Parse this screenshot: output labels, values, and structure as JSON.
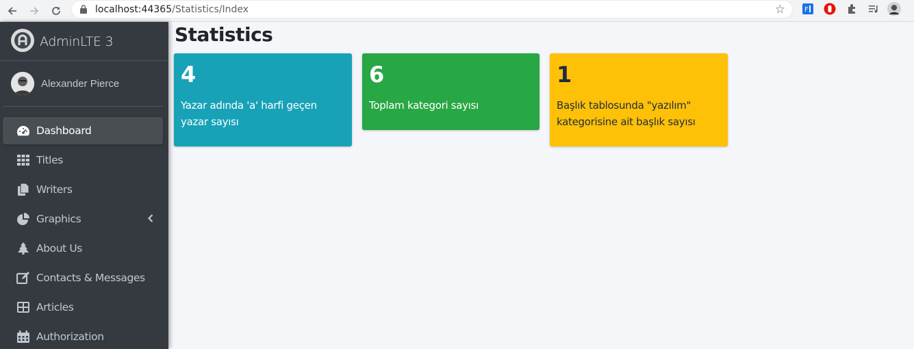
{
  "browser": {
    "url_host": "localhost:44365",
    "url_path": "/Statistics/Index"
  },
  "brand": {
    "name": "AdminLTE 3"
  },
  "user": {
    "name": "Alexander Pierce"
  },
  "menu": [
    {
      "label": "Dashboard",
      "icon": "tachometer-icon",
      "active": true
    },
    {
      "label": "Titles",
      "icon": "table-grid-icon"
    },
    {
      "label": "Writers",
      "icon": "copy-icon"
    },
    {
      "label": "Graphics",
      "icon": "pie-chart-icon",
      "has_chevron": true
    },
    {
      "label": "About Us",
      "icon": "tree-icon"
    },
    {
      "label": "Contacts & Messages",
      "icon": "edit-icon"
    },
    {
      "label": "Articles",
      "icon": "th-large-icon"
    },
    {
      "label": "Authorization",
      "icon": "calendar-icon"
    }
  ],
  "page": {
    "title": "Statistics"
  },
  "cards": [
    {
      "value": "4",
      "text": "Yazar adında 'a' harfi geçen yazar sayısı",
      "color": "#17a2b8"
    },
    {
      "value": "6",
      "text": "Toplam kategori sayısı",
      "color": "#28a745"
    },
    {
      "value": "1",
      "text": "Başlık tablosunda \"yazılım\" kategorisine ait başlık sayısı",
      "color": "#ffc107"
    }
  ],
  "colors": {
    "sidebar_bg": "#343a40",
    "content_bg": "#f4f6f9",
    "info": "#17a2b8",
    "success": "#28a745",
    "warning": "#ffc107"
  }
}
